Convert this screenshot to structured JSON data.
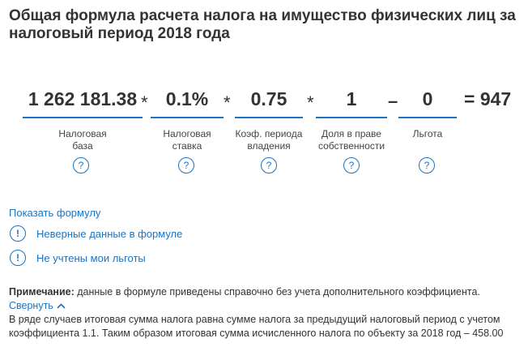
{
  "title": "Общая формула расчета налога на имущество физических лиц за налоговый период 2018 года",
  "formula": {
    "terms": [
      {
        "value": "1 262 181.38",
        "caption": "Налоговая\nбаза"
      },
      {
        "value": "0.1%",
        "caption": "Налоговая\nставка"
      },
      {
        "value": "0.75",
        "caption": "Коэф. периода\nвладения"
      },
      {
        "value": "1",
        "caption": "Доля в праве\nсобственности"
      },
      {
        "value": "0",
        "caption": "Льгота"
      }
    ],
    "operators": [
      "*",
      "*",
      "*",
      "–"
    ],
    "result": "= 947",
    "help_icon": "?"
  },
  "links": {
    "show_formula": "Показать формулу",
    "wrong_data": "Неверные данные в формуле",
    "benefits_missing": "Не учтены мои льготы",
    "alert_icon": "!"
  },
  "note": {
    "label": "Примечание:",
    "text": "данные в формуле приведены справочно без учета дополнительного коэффициента.",
    "collapse": "Свернуть",
    "details": "В ряде случаев итоговая сумма налога равна сумме налога за предыдущий налоговый период с учетом коэффициента 1.1. Таким образом итоговая сумма исчисленного налога по объекту за 2018 год – 458.00"
  },
  "colors": {
    "accent": "#1a73c4",
    "text": "#333333"
  }
}
